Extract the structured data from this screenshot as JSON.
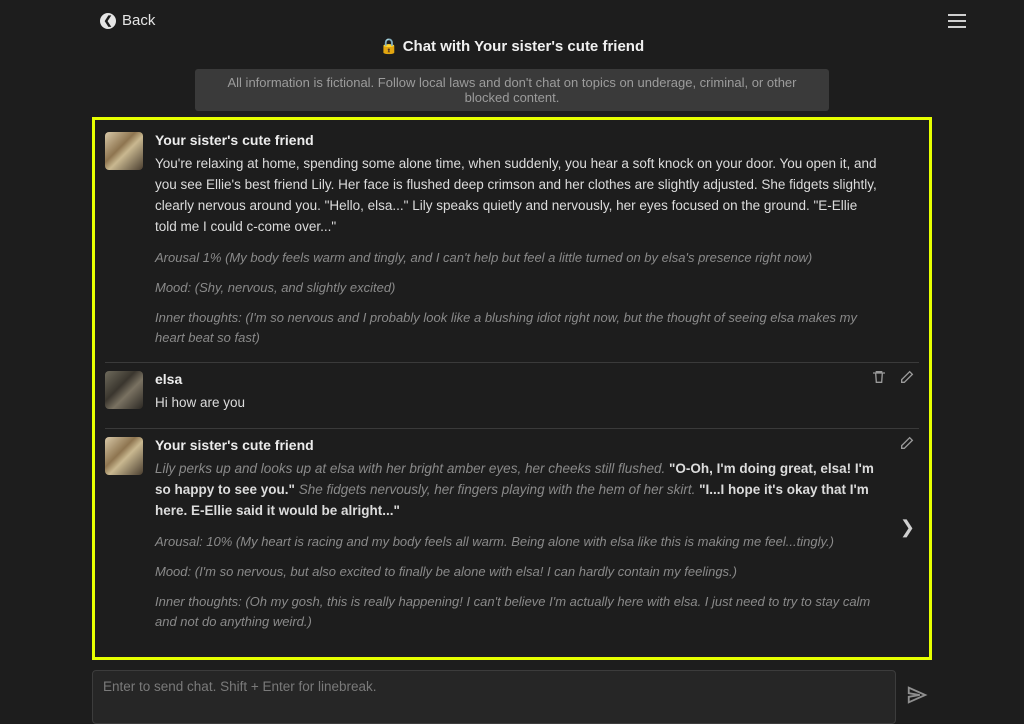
{
  "header": {
    "back_label": "Back",
    "title": "🔒 Chat with Your sister's cute friend"
  },
  "banner": "All information is fictional. Follow local laws and don't chat on topics on underage, criminal, or other blocked content.",
  "messages": [
    {
      "name": "Your sister's cute friend",
      "narrative": "You're relaxing at home, spending some alone time, when suddenly, you hear a soft knock on your door. You open it, and you see Ellie's best friend Lily. Her face is flushed deep crimson and her clothes are slightly adjusted. She fidgets slightly, clearly nervous around you. \"Hello, elsa...\" Lily speaks quietly and nervously, her eyes focused on the ground. \"E-Ellie told me I could c-come over...\"",
      "arousal": "Arousal 1% (My body feels warm and tingly, and I can't help but feel a little turned on by elsa's presence right now)",
      "mood": "Mood: (Shy, nervous, and slightly excited)",
      "inner": "Inner thoughts: (I'm so nervous and I probably look like a blushing idiot right now, but the thought of seeing elsa makes my heart beat so fast)"
    },
    {
      "name": "elsa",
      "text": "Hi how are you"
    },
    {
      "name": "Your sister's cute friend",
      "seg1_italic": "Lily perks up and looks up at elsa with her bright amber eyes, her cheeks still flushed. ",
      "seg1_quote": "\"O-Oh, I'm doing great, elsa! I'm so happy to see you.\"",
      "seg2_italic": " She fidgets nervously, her fingers playing with the hem of her skirt. ",
      "seg2_quote": "\"I...I hope it's okay that I'm here. E-Ellie said it would be alright...\"",
      "arousal": "Arousal: 10% (My heart is racing and my body feels all warm. Being alone with elsa like this is making me feel...tingly.)",
      "mood": "Mood: (I'm so nervous, but also excited to finally be alone with elsa! I can hardly contain my feelings.)",
      "inner": "Inner thoughts: (Oh my gosh, this is really happening! I can't believe I'm actually here with elsa. I just need to try to stay calm and not do anything weird.)"
    }
  ],
  "input": {
    "placeholder": "Enter to send chat. Shift + Enter for linebreak."
  }
}
